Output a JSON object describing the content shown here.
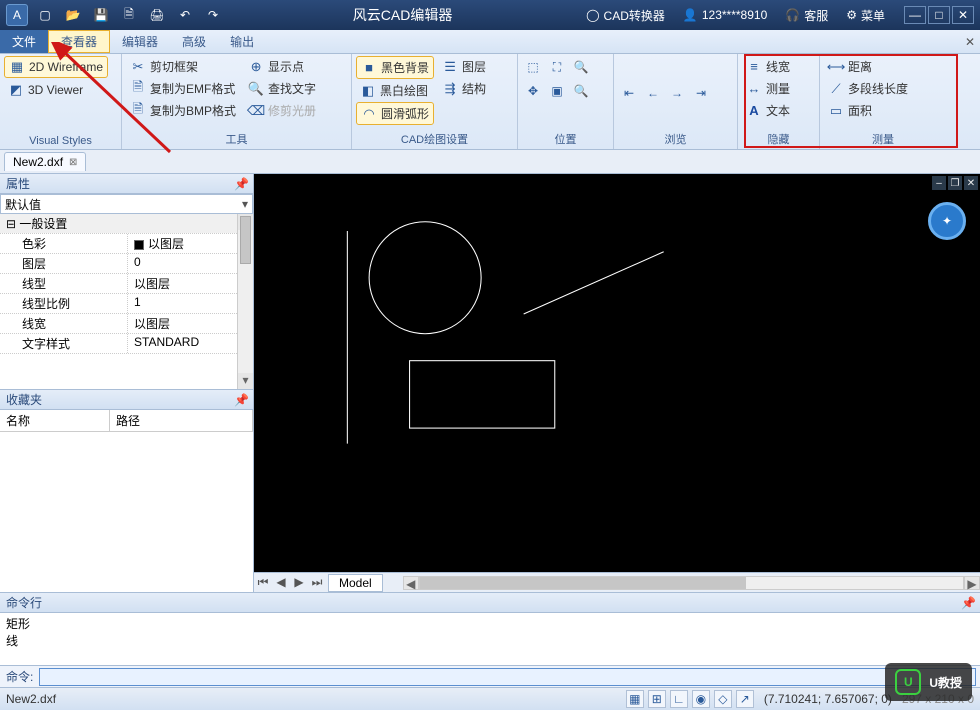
{
  "titlebar": {
    "app_title": "风云CAD编辑器",
    "cad_converter": "CAD转换器",
    "user": "123****8910",
    "support": "客服",
    "menu": "菜单"
  },
  "menubar": {
    "items": [
      "文件",
      "查看器",
      "编辑器",
      "高级",
      "输出"
    ]
  },
  "ribbon": {
    "visual_styles": {
      "label": "Visual Styles",
      "wireframe": "2D Wireframe",
      "viewer3d": "3D Viewer"
    },
    "tools": {
      "label": "工具",
      "clip_frame": "剪切框架",
      "copy_emf": "复制为EMF格式",
      "copy_bmp": "复制为BMP格式",
      "show_point": "显示点",
      "find_text": "查找文字",
      "trim_album": "修剪光册"
    },
    "cad_settings": {
      "label": "CAD绘图设置",
      "black_bg": "黑色背景",
      "bw_draw": "黑白绘图",
      "smooth_arc": "圆滑弧形",
      "layers": "图层",
      "structure": "结构"
    },
    "position": {
      "label": "位置"
    },
    "browse": {
      "label": "浏览"
    },
    "hide": {
      "label": "隐藏",
      "linewidth": "线宽",
      "measure": "测量",
      "text": "文本"
    },
    "measure": {
      "label": "测量",
      "distance": "距离",
      "polyline": "多段线长度",
      "area": "面积"
    }
  },
  "doctab": {
    "name": "New2.dxf"
  },
  "properties": {
    "title": "属性",
    "combo": "默认值",
    "section": "一般设置",
    "rows": [
      {
        "k": "色彩",
        "v": "以图层",
        "swatch": true
      },
      {
        "k": "图层",
        "v": "0"
      },
      {
        "k": "线型",
        "v": "以图层"
      },
      {
        "k": "线型比例",
        "v": "1"
      },
      {
        "k": "线宽",
        "v": "以图层"
      },
      {
        "k": "文字样式",
        "v": "STANDARD"
      }
    ]
  },
  "favorites": {
    "title": "收藏夹",
    "cols": [
      "名称",
      "路径"
    ]
  },
  "model_tab": "Model",
  "command": {
    "title": "命令行",
    "log": [
      "矩形",
      "线"
    ],
    "prompt": "命令:"
  },
  "statusbar": {
    "file": "New2.dxf",
    "coords": "(7.710241; 7.657067; 0)",
    "dims": "297 x 210 x 0"
  },
  "watermark": "U教授",
  "colors": {
    "accent": "#3a6aa8",
    "highlight": "#d01818"
  }
}
